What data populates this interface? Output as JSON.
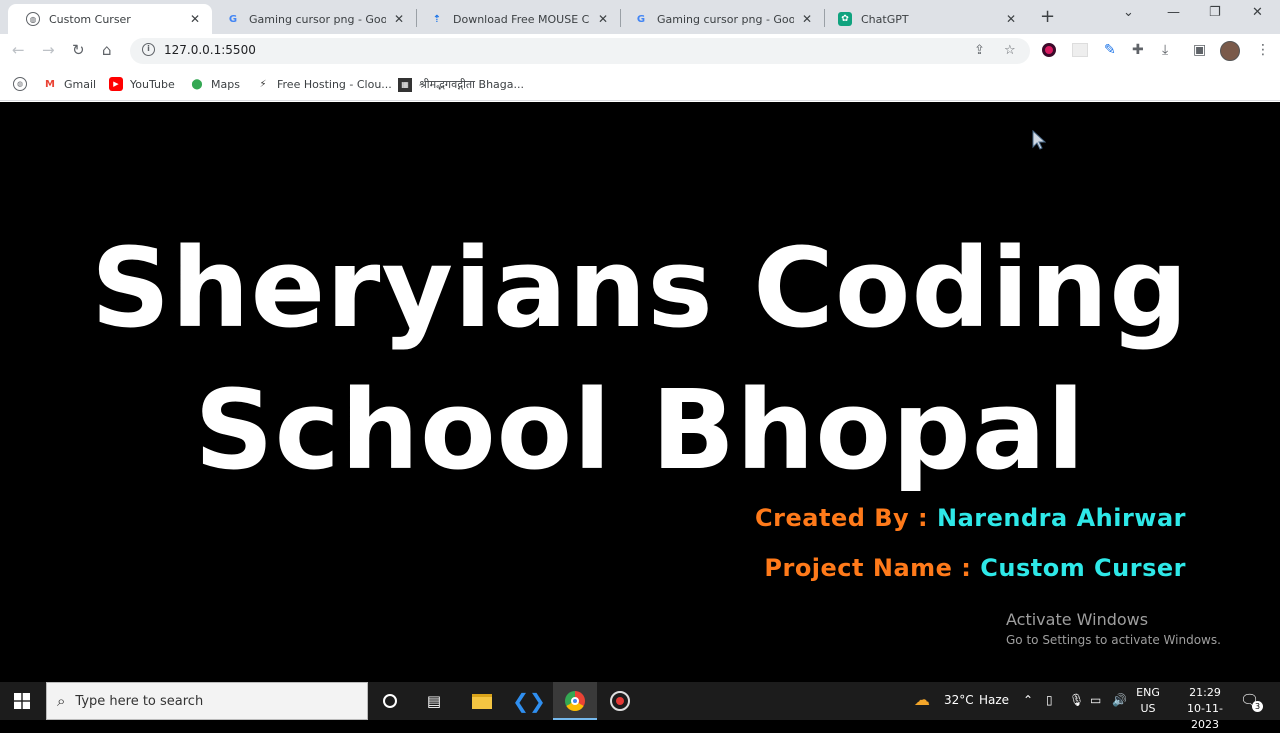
{
  "browser": {
    "tabs": [
      {
        "title": "Custom Curser",
        "active": true
      },
      {
        "title": "Gaming cursor png - Google",
        "active": false
      },
      {
        "title": "Download Free MOUSE CUR",
        "active": false
      },
      {
        "title": "Gaming cursor png - Google",
        "active": false
      },
      {
        "title": "ChatGPT",
        "active": false
      }
    ],
    "url": "127.0.0.1:5500",
    "bookmarks": [
      {
        "label": "Gmail"
      },
      {
        "label": "YouTube"
      },
      {
        "label": "Maps"
      },
      {
        "label": "Free Hosting - Clou..."
      },
      {
        "label": "श्रीमद्भगवद्गीता Bhaga..."
      }
    ]
  },
  "page": {
    "heading_line1": "Sheryians Coding",
    "heading_line2": "School Bhopal",
    "created_by_label": "Created By :",
    "created_by_value": "Narendra Ahirwar",
    "project_name_label": "Project Name :",
    "project_name_value": "Custom Curser",
    "activate_title": "Activate Windows",
    "activate_sub": "Go to Settings to activate Windows."
  },
  "taskbar": {
    "search_placeholder": "Type here to search",
    "weather_temp": "32°C",
    "weather_desc": "Haze",
    "lang_top": "ENG",
    "lang_bottom": "US",
    "time": "21:29",
    "date": "10-11-2023",
    "notification_count": "3"
  },
  "colors": {
    "label_orange": "#ff7a1a",
    "value_cyan": "#2ee8e8",
    "page_bg": "#000000"
  }
}
